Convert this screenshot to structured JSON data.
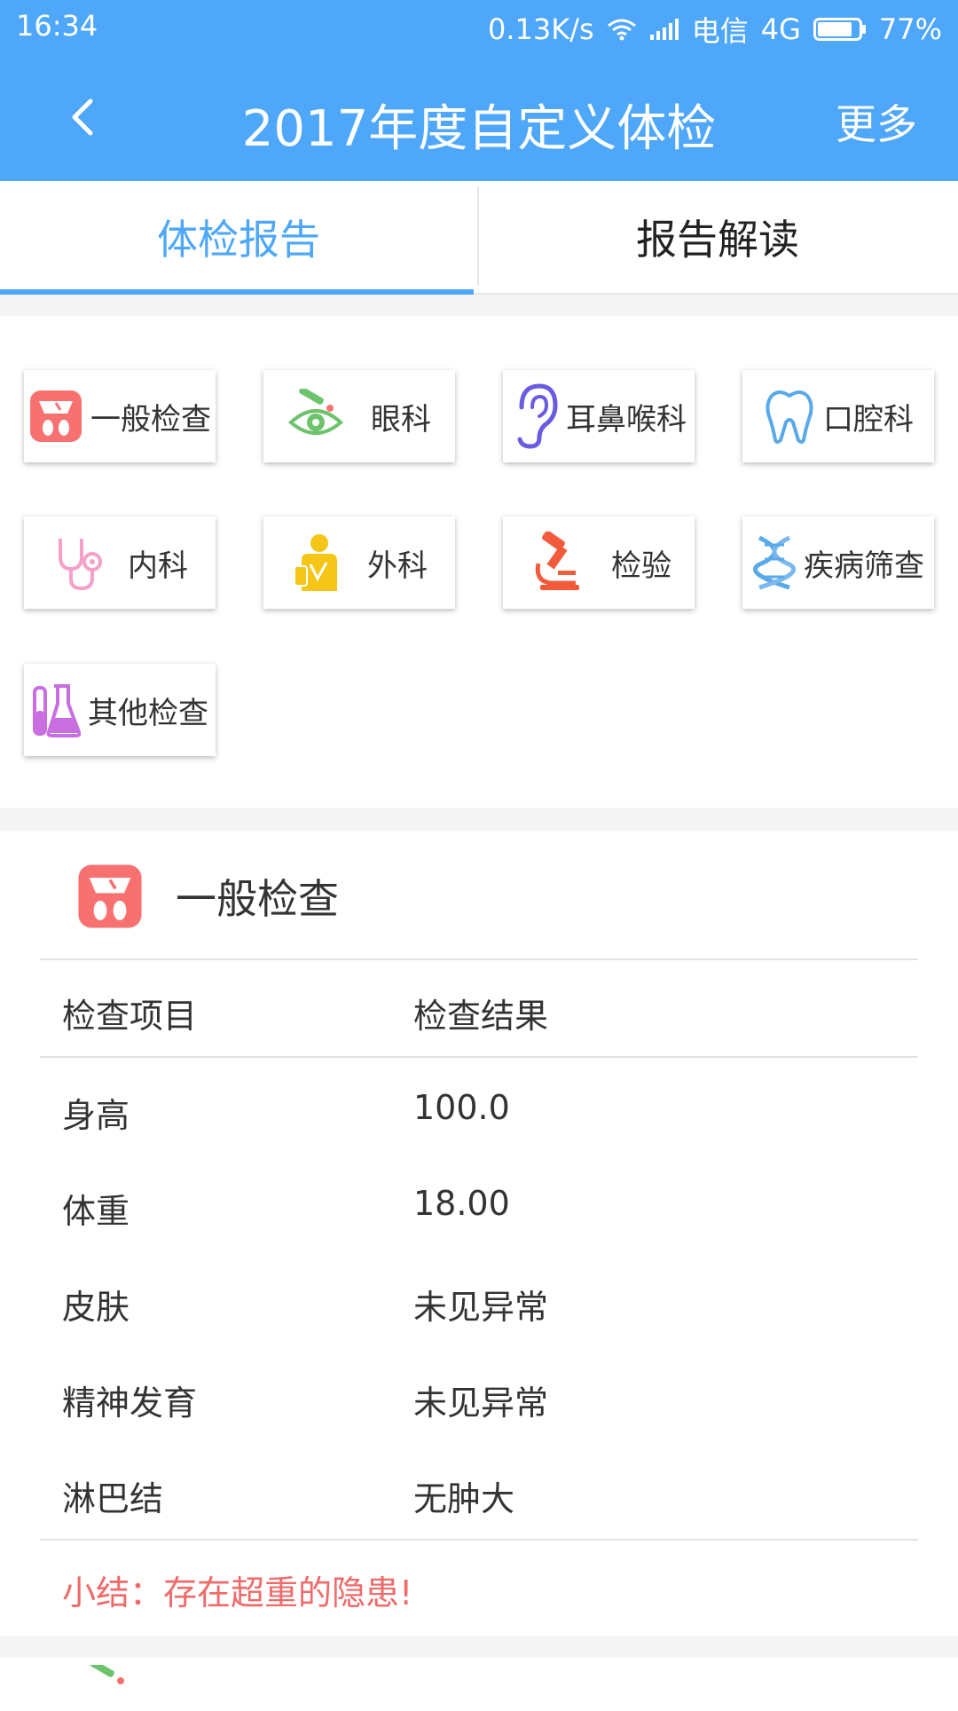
{
  "status_bar": {
    "time": "16:34",
    "speed": "0.13K/s",
    "carrier": "电信",
    "network": "4G",
    "battery": "77%"
  },
  "app_bar": {
    "title": "2017年度自定义体检",
    "more_label": "更多"
  },
  "tabs": [
    {
      "label": "体检报告",
      "active": true
    },
    {
      "label": "报告解读",
      "active": false
    }
  ],
  "categories": [
    {
      "label": "一般检查",
      "icon": "scale-icon"
    },
    {
      "label": "眼科",
      "icon": "eye-icon"
    },
    {
      "label": "耳鼻喉科",
      "icon": "ear-icon"
    },
    {
      "label": "口腔科",
      "icon": "tooth-icon"
    },
    {
      "label": "内科",
      "icon": "stethoscope-icon"
    },
    {
      "label": "外科",
      "icon": "surgeon-icon"
    },
    {
      "label": "检验",
      "icon": "microscope-icon"
    },
    {
      "label": "疾病筛查",
      "icon": "dna-icon"
    },
    {
      "label": "其他检查",
      "icon": "flask-icon"
    }
  ],
  "section": {
    "title": "一般检查",
    "icon": "scale-icon",
    "columns": [
      "检查项目",
      "检查结果"
    ],
    "rows": [
      {
        "item": "身高",
        "result": "100.0"
      },
      {
        "item": "体重",
        "result": "18.00"
      },
      {
        "item": "皮肤",
        "result": "未见异常"
      },
      {
        "item": "精神发育",
        "result": "未见异常"
      },
      {
        "item": "淋巴结",
        "result": "无肿大"
      }
    ],
    "summary": "小结：存在超重的隐患!"
  },
  "colors": {
    "primary": "#4ea7f8",
    "warning": "#f06a6a"
  }
}
